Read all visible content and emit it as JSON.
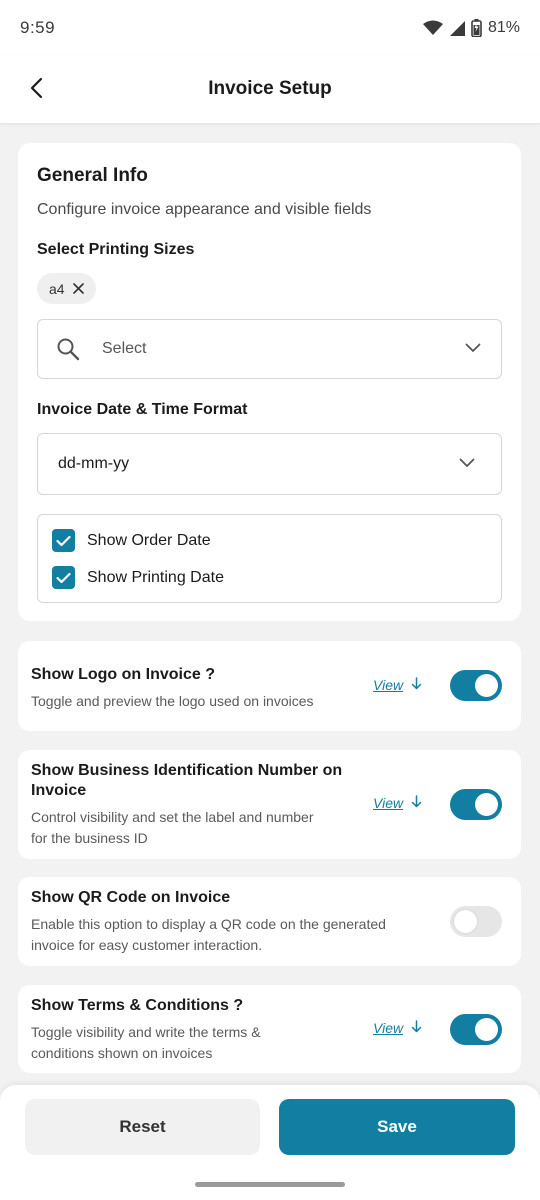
{
  "status_bar": {
    "time": "9:59",
    "battery": "81%",
    "icons": [
      "wifi-icon",
      "signal-icon",
      "battery-icon"
    ]
  },
  "header": {
    "title": "Invoice Setup",
    "back_icon": "chevron-left-icon"
  },
  "general_info": {
    "title": "General Info",
    "subtitle": "Configure invoice appearance and visible fields",
    "printing_sizes_label": "Select Printing Sizes",
    "selected_chip": "a4",
    "select_placeholder": "Select",
    "date_format_label": "Invoice Date & Time Format",
    "date_format_value": "dd-mm-yy",
    "checkboxes": [
      {
        "label": "Show Order Date",
        "checked": true
      },
      {
        "label": "Show Printing Date",
        "checked": true
      }
    ]
  },
  "options": [
    {
      "title": "Show Logo on Invoice ?",
      "description": "Toggle and preview the logo used on invoices",
      "view_label": "View",
      "enabled": true
    },
    {
      "title_line1": "Show Business Identification Number on",
      "title_line2": "Invoice",
      "description_line1": "Control visibility and set the label and number",
      "description_line2": "for the business ID",
      "view_label": "View",
      "enabled": true
    },
    {
      "title": "Show QR Code on Invoice",
      "description_line1": "Enable this option to display a QR code on the generated",
      "description_line2": "invoice for easy customer interaction.",
      "enabled": false
    },
    {
      "title": "Show Terms & Conditions ?",
      "description_line1": "Toggle visibility and write the terms &",
      "description_line2": "conditions shown on invoices",
      "view_label": "View",
      "enabled": true
    }
  ],
  "footer": {
    "reset_label": "Reset",
    "save_label": "Save"
  },
  "colors": {
    "accent": "#127ea2",
    "toggle_off": "#e6e6e6",
    "background": "#f2f2f2"
  }
}
